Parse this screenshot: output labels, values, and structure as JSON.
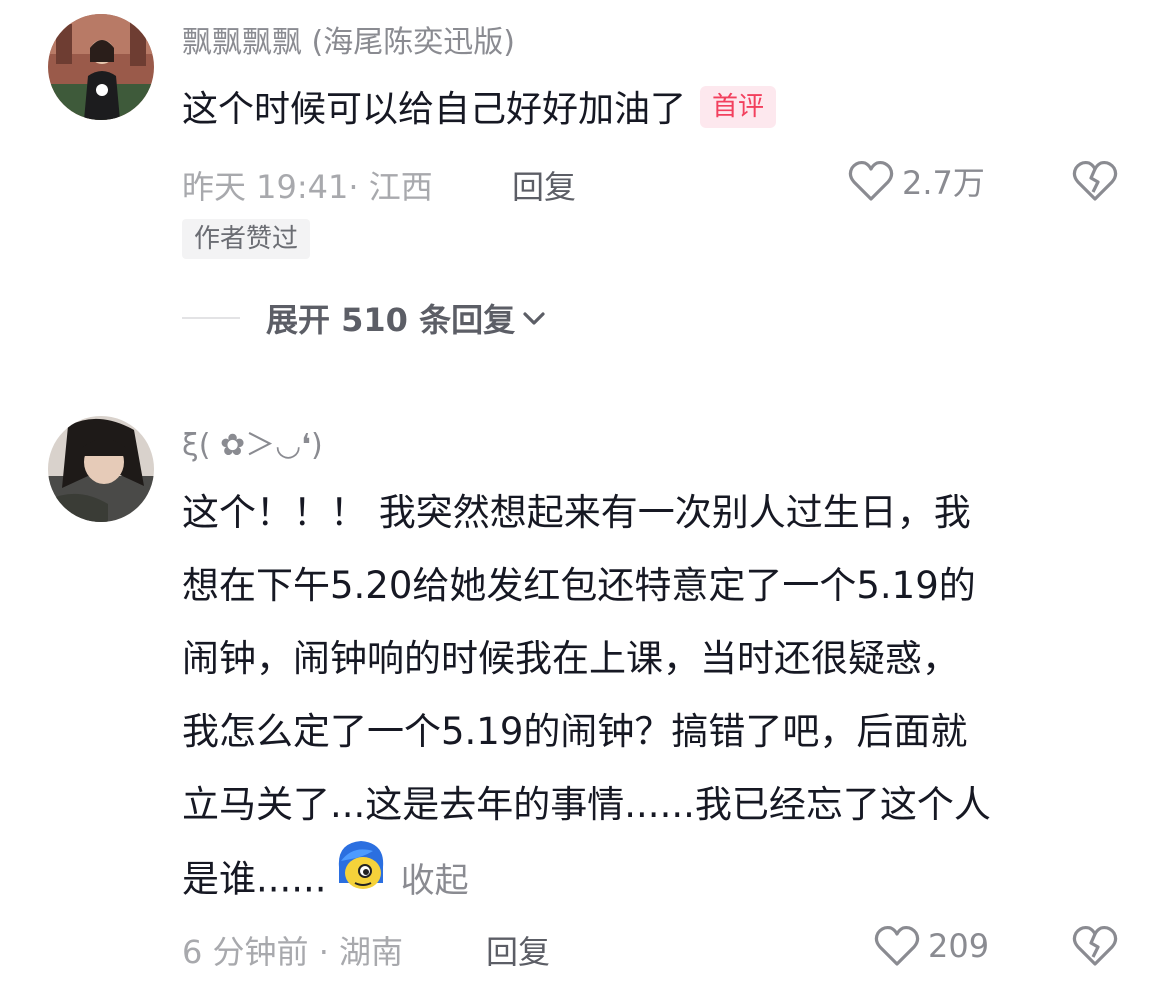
{
  "comments": [
    {
      "username": "飘飘飘飘 (海尾陈奕迅版)",
      "text": "这个时候可以给自己好好加油了",
      "badge": "首评",
      "meta": "昨天 19:41· 江西",
      "reply_label": "回复",
      "likes": "2.7万",
      "author_liked_tag": "作者赞过",
      "expand_label": "展开 510 条回复"
    },
    {
      "username": "ξ( ✿＞◡❛)",
      "text_lines": [
        "这个！！！ 我突然想起来有一次别人过生日，我",
        "想在下午5.20给她发红包还特意定了一个5.19的",
        "闹钟，闹钟响的时候我在上课，当时还很疑惑，",
        "我怎么定了一个5.19的闹钟？搞错了吧，后面就",
        "立马关了...这是去年的事情......我已经忘了这个人",
        "是谁......"
      ],
      "collapse_label": "收起",
      "meta": "6 分钟前 · 湖南",
      "reply_label": "回复",
      "likes": "209"
    }
  ],
  "icons": {
    "like": "heart-outline-icon",
    "dislike": "broken-heart-icon",
    "expand": "chevron-down-icon",
    "emoji": "blue-hair-face-emoji"
  },
  "colors": {
    "badge_text": "#f2405e",
    "badge_bg": "#fde8ee",
    "primary_text": "#161823",
    "secondary_text": "#8a8b91"
  }
}
